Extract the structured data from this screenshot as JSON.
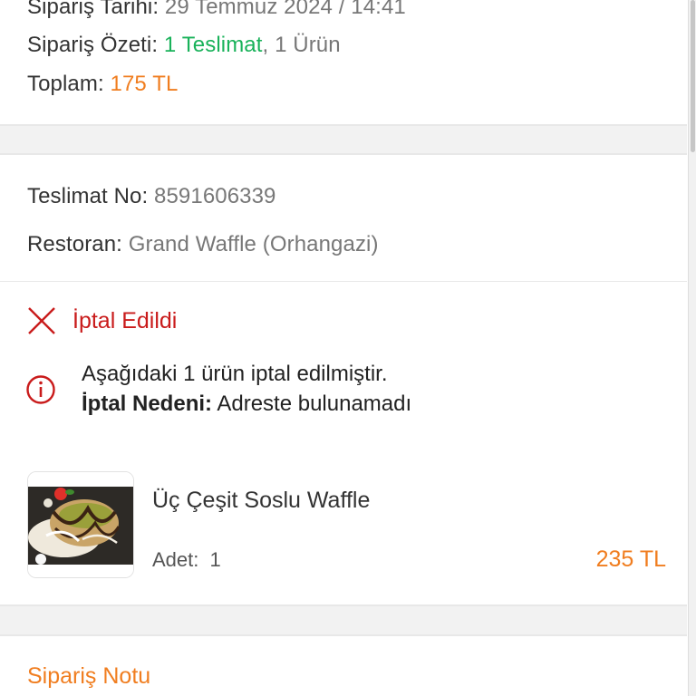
{
  "order": {
    "date_label": "Sipariş Tarihi:",
    "date_value": "29 Temmuz 2024 / 14:41",
    "summary_label": "Sipariş Özeti:",
    "summary_deliveries": "1 Teslimat",
    "summary_separator": ", ",
    "summary_items": "1 Ürün",
    "total_label": "Toplam:",
    "total_value": "175 TL"
  },
  "delivery": {
    "no_label": "Teslimat No:",
    "no_value": "8591606339",
    "restaurant_label": "Restoran:",
    "restaurant_value": "Grand Waffle (Orhangazi)"
  },
  "status": {
    "text": "İptal Edildi",
    "icon": "close-x-icon",
    "color": "#c91b1b"
  },
  "cancel_info": {
    "icon": "info-circle-icon",
    "message": "Aşağıdaki 1 ürün iptal edilmiştir.",
    "reason_label": "İptal Nedeni:",
    "reason_value": "Adreste bulunamadı"
  },
  "product": {
    "name": "Üç Çeşit Soslu Waffle",
    "qty_label": "Adet:",
    "qty_value": "1",
    "price": "235 TL",
    "image": "waffle-image"
  },
  "note": {
    "title": "Sipariş Notu"
  },
  "colors": {
    "accent": "#f07d1f",
    "success": "#19b25a",
    "danger": "#c91b1b"
  }
}
